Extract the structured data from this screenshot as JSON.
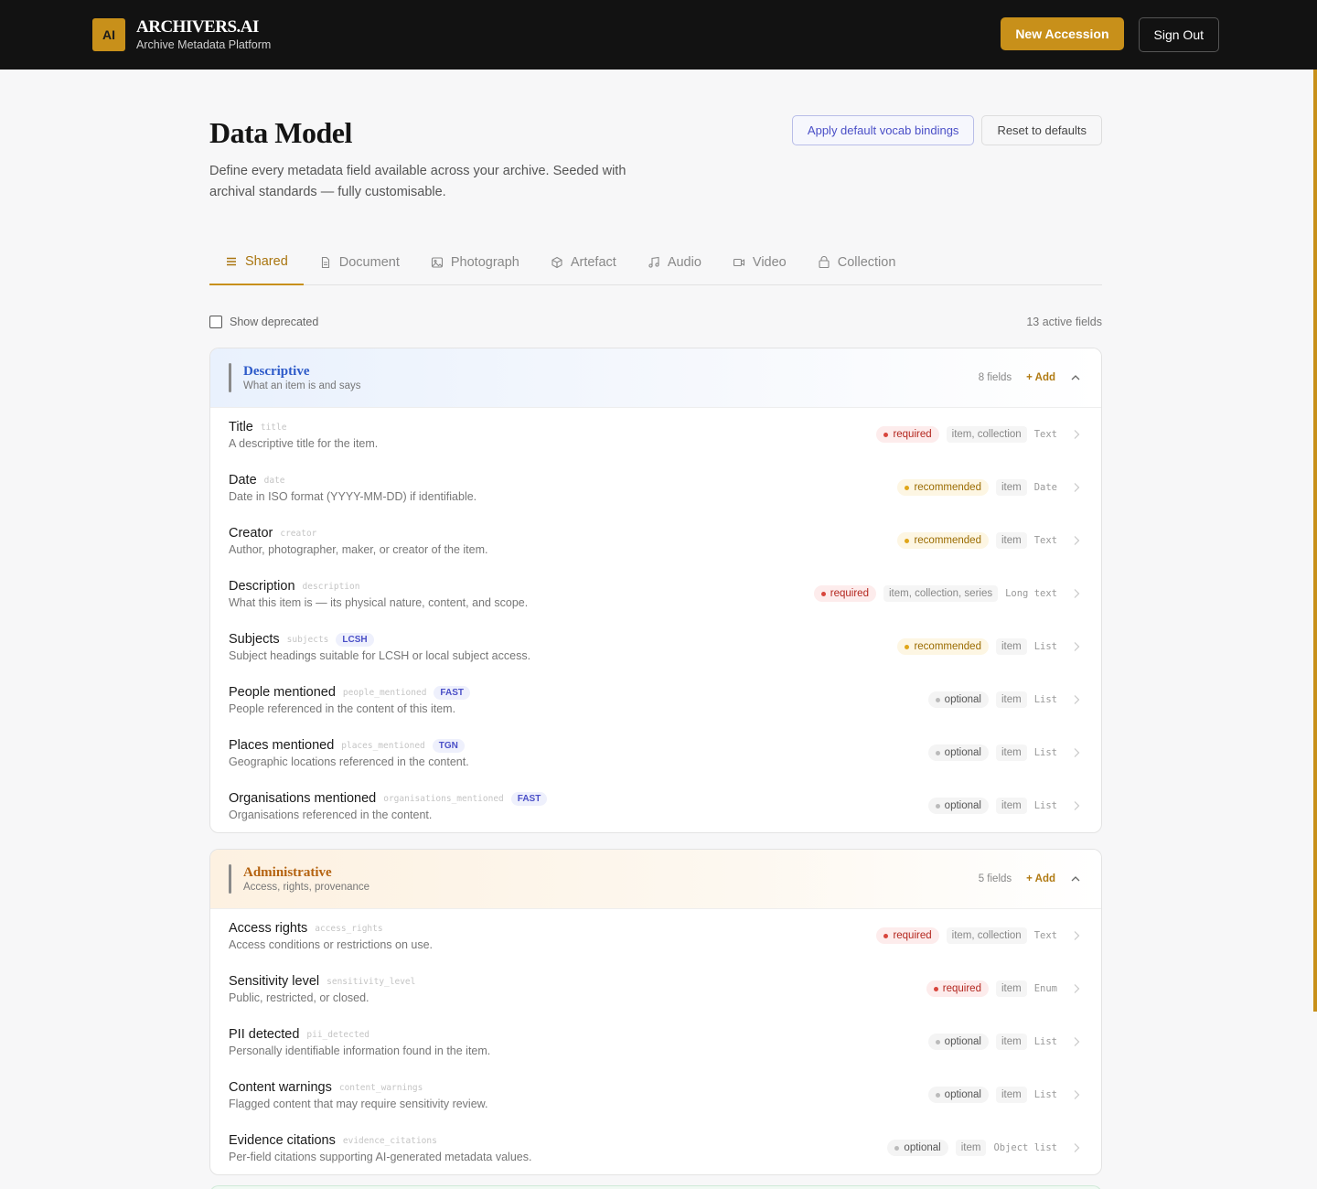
{
  "app": {
    "logo_text": "AI",
    "name": "ARCHIVERS.AI",
    "subtitle": "Archive Metadata Platform",
    "new_accession_label": "New Accession",
    "sign_out_label": "Sign Out",
    "accent_color": "#c8901a"
  },
  "page": {
    "title": "Data Model",
    "description": "Define every metadata field available across your archive. Seeded with archival standards — fully customisable.",
    "apply_vocab_label": "Apply default vocab bindings",
    "reset_label": "Reset to defaults"
  },
  "tabs": [
    {
      "label": "Shared",
      "icon": "list-icon",
      "active": true
    },
    {
      "label": "Document",
      "icon": "document-icon",
      "active": false
    },
    {
      "label": "Photograph",
      "icon": "image-icon",
      "active": false
    },
    {
      "label": "Artefact",
      "icon": "cube-icon",
      "active": false
    },
    {
      "label": "Audio",
      "icon": "music-note-icon",
      "active": false
    },
    {
      "label": "Video",
      "icon": "video-icon",
      "active": false
    },
    {
      "label": "Collection",
      "icon": "archive-box-icon",
      "active": false
    }
  ],
  "filters": {
    "show_deprecated_label": "Show deprecated",
    "show_deprecated_checked": false,
    "active_fields_text": "13 active fields"
  },
  "groups": [
    {
      "name": "Descriptive",
      "description": "What an item is and says",
      "count_text": "8 fields",
      "add_label": "+ Add",
      "color": "#2e5bc9",
      "fields": [
        {
          "name": "Title",
          "key": "title",
          "vocab": "",
          "description": "A descriptive title for the item.",
          "level": "required",
          "scope": "item, collection",
          "type": "Text"
        },
        {
          "name": "Date",
          "key": "date",
          "vocab": "",
          "description": "Date in ISO format (YYYY-MM-DD) if identifiable.",
          "level": "recommended",
          "scope": "item",
          "type": "Date"
        },
        {
          "name": "Creator",
          "key": "creator",
          "vocab": "",
          "description": "Author, photographer, maker, or creator of the item.",
          "level": "recommended",
          "scope": "item",
          "type": "Text"
        },
        {
          "name": "Description",
          "key": "description",
          "vocab": "",
          "description": "What this item is — its physical nature, content, and scope.",
          "level": "required",
          "scope": "item, collection, series",
          "type": "Long text"
        },
        {
          "name": "Subjects",
          "key": "subjects",
          "vocab": "LCSH",
          "description": "Subject headings suitable for LCSH or local subject access.",
          "level": "recommended",
          "scope": "item",
          "type": "List"
        },
        {
          "name": "People mentioned",
          "key": "people_mentioned",
          "vocab": "FAST",
          "description": "People referenced in the content of this item.",
          "level": "optional",
          "scope": "item",
          "type": "List"
        },
        {
          "name": "Places mentioned",
          "key": "places_mentioned",
          "vocab": "TGN",
          "description": "Geographic locations referenced in the content.",
          "level": "optional",
          "scope": "item",
          "type": "List"
        },
        {
          "name": "Organisations mentioned",
          "key": "organisations_mentioned",
          "vocab": "FAST",
          "description": "Organisations referenced in the content.",
          "level": "optional",
          "scope": "item",
          "type": "List"
        }
      ]
    },
    {
      "name": "Administrative",
      "description": "Access, rights, provenance",
      "count_text": "5 fields",
      "add_label": "+ Add",
      "color": "#b4620f",
      "fields": [
        {
          "name": "Access rights",
          "key": "access_rights",
          "vocab": "",
          "description": "Access conditions or restrictions on use.",
          "level": "required",
          "scope": "item, collection",
          "type": "Text"
        },
        {
          "name": "Sensitivity level",
          "key": "sensitivity_level",
          "vocab": "",
          "description": "Public, restricted, or closed.",
          "level": "required",
          "scope": "item",
          "type": "Enum"
        },
        {
          "name": "PII detected",
          "key": "pii_detected",
          "vocab": "",
          "description": "Personally identifiable information found in the item.",
          "level": "optional",
          "scope": "item",
          "type": "List"
        },
        {
          "name": "Content warnings",
          "key": "content_warnings",
          "vocab": "",
          "description": "Flagged content that may require sensitivity review.",
          "level": "optional",
          "scope": "item",
          "type": "List"
        },
        {
          "name": "Evidence citations",
          "key": "evidence_citations",
          "vocab": "",
          "description": "Per-field citations supporting AI-generated metadata values.",
          "level": "optional",
          "scope": "item",
          "type": "Object list"
        }
      ]
    }
  ]
}
